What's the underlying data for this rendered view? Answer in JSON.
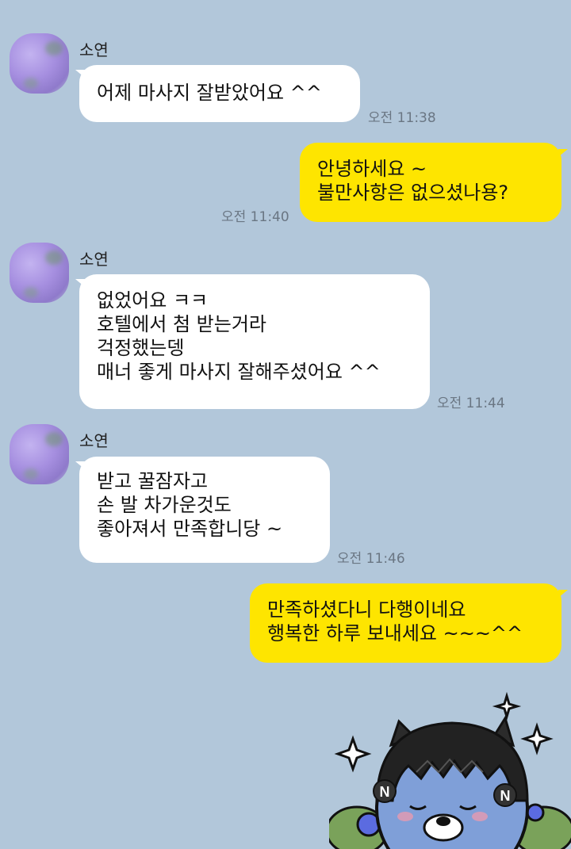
{
  "chat": {
    "messages": [
      {
        "sender": "소연",
        "lines": [
          "어제 마사지 잘받았어요 ^^"
        ],
        "time": "오전 11:38"
      },
      {
        "sender": "",
        "lines": [
          "안녕하세요 ~",
          "불만사항은 없으셨나용?"
        ],
        "time": "오전 11:40"
      },
      {
        "sender": "소연",
        "lines": [
          "없었어요 ㅋㅋ",
          "호텔에서 첨 받는거라",
          "걱정했는뎅",
          "매너 좋게 마사지 잘해주셨어요 ^^"
        ],
        "time": "오전 11:44"
      },
      {
        "sender": "소연",
        "lines": [
          "받고 꿀잠자고",
          "손 발 차가운것도",
          "좋아져서 만족합니당 ~"
        ],
        "time": "오전 11:46"
      },
      {
        "sender": "",
        "lines": [
          "만족하셨다니 다행이네요",
          "행복한 하루 보내세요 ~~~^^"
        ],
        "time": ""
      }
    ]
  },
  "colors": {
    "background": "#b2c7da",
    "incoming": "#ffffff",
    "outgoing": "#fee500"
  },
  "sticker": {
    "letter_left": "N",
    "letter_right": "N"
  }
}
